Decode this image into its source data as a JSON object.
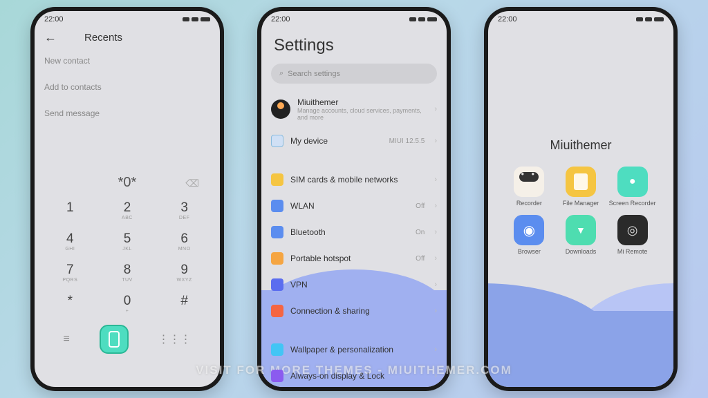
{
  "statusbar": {
    "time": "22:00"
  },
  "phone1": {
    "title": "Recents",
    "menu": [
      "New contact",
      "Add to contacts",
      "Send message"
    ],
    "dialed": "*0*",
    "keys": [
      [
        "1",
        ""
      ],
      [
        "2",
        "ABC"
      ],
      [
        "3",
        "DEF"
      ],
      [
        "4",
        "GHI"
      ],
      [
        "5",
        "JKL"
      ],
      [
        "6",
        "MNO"
      ],
      [
        "7",
        "PQRS"
      ],
      [
        "8",
        "TUV"
      ],
      [
        "9",
        "WXYZ"
      ],
      [
        "*",
        ""
      ],
      [
        "0",
        "+"
      ],
      [
        "#",
        ""
      ]
    ]
  },
  "phone2": {
    "title": "Settings",
    "search_placeholder": "Search settings",
    "account": {
      "name": "Miuithemer",
      "sub": "Manage accounts, cloud services, payments, and more"
    },
    "mydevice": {
      "label": "My device",
      "value": "MIUI 12.5.5"
    },
    "items": [
      {
        "label": "SIM cards & mobile networks",
        "value": "",
        "color": "#f5c542"
      },
      {
        "label": "WLAN",
        "value": "Off",
        "color": "#5b8def"
      },
      {
        "label": "Bluetooth",
        "value": "On",
        "color": "#5b8def"
      },
      {
        "label": "Portable hotspot",
        "value": "Off",
        "color": "#f5a542"
      },
      {
        "label": "VPN",
        "value": "",
        "color": "#5b6def"
      },
      {
        "label": "Connection & sharing",
        "value": "",
        "color": "#f56542"
      },
      {
        "label": "",
        "value": "",
        "color": ""
      },
      {
        "label": "Wallpaper & personalization",
        "value": "",
        "color": "#42c5f5"
      },
      {
        "label": "Always-on display & Lock",
        "value": "",
        "color": "#8b5bef"
      }
    ]
  },
  "phone3": {
    "folder_name": "Miuithemer",
    "apps": [
      {
        "label": "Recorder",
        "icon": "ic-recorder"
      },
      {
        "label": "File Manager",
        "icon": "ic-filemgr"
      },
      {
        "label": "Screen Recorder",
        "icon": "ic-screenrec"
      },
      {
        "label": "Browser",
        "icon": "ic-browser"
      },
      {
        "label": "Downloads",
        "icon": "ic-downloads"
      },
      {
        "label": "Mi Remote",
        "icon": "ic-remote"
      }
    ]
  },
  "watermark": "VISIT FOR MORE THEMES - MIUITHEMER.COM"
}
